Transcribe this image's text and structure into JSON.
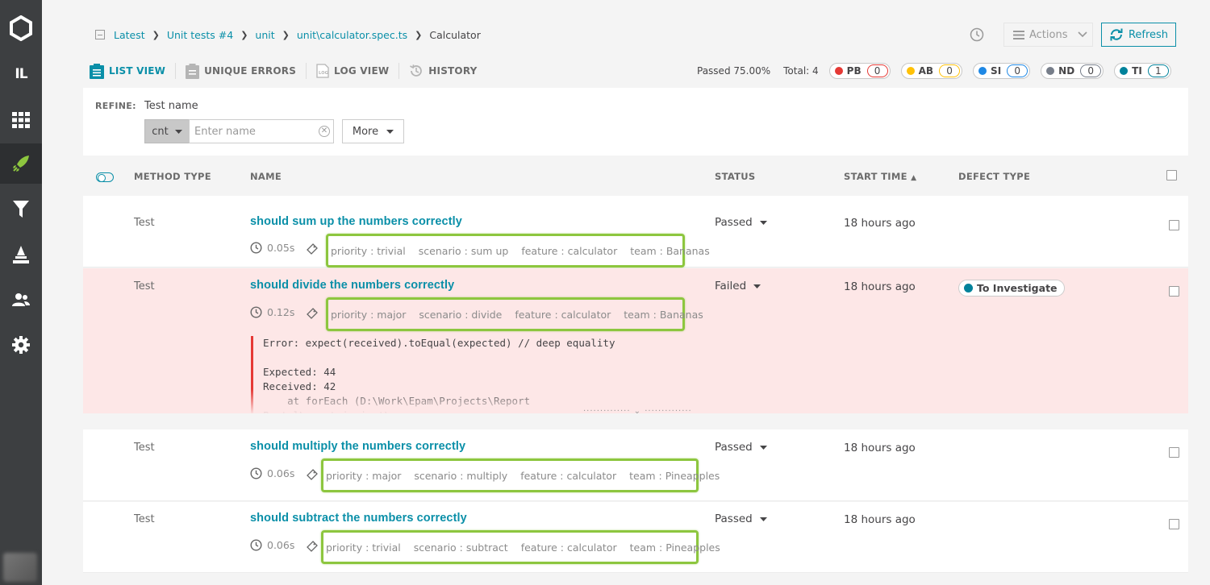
{
  "sidebar": {
    "logo": "reportportal-logo-icon",
    "project_initials": "IL"
  },
  "breadcrumb": {
    "items": [
      "Latest",
      "Unit tests #4",
      "unit",
      "unit\\calculator.spec.ts"
    ],
    "current": "Calculator"
  },
  "header": {
    "actions_label": "Actions",
    "refresh_label": "Refresh"
  },
  "view_tabs": [
    {
      "label": "LIST VIEW",
      "active": true
    },
    {
      "label": "UNIQUE ERRORS",
      "active": false
    },
    {
      "label": "LOG VIEW",
      "active": false
    },
    {
      "label": "HISTORY",
      "active": false
    }
  ],
  "stats": {
    "passed": "Passed 75.00%",
    "total": "Total: 4",
    "defects": [
      {
        "code": "PB",
        "count": "0",
        "color": "#e53935"
      },
      {
        "code": "AB",
        "count": "0",
        "color": "#ffc107"
      },
      {
        "code": "SI",
        "count": "0",
        "color": "#1e88e5"
      },
      {
        "code": "ND",
        "count": "0",
        "color": "#777e8a"
      },
      {
        "code": "TI",
        "count": "1",
        "color": "#00829b"
      }
    ]
  },
  "refine": {
    "label": "REFINE:",
    "filter_name": "Test name",
    "condition": "cnt",
    "input_placeholder": "Enter name",
    "more_label": "More"
  },
  "table": {
    "columns": {
      "method_type": "METHOD TYPE",
      "name": "NAME",
      "status": "STATUS",
      "start_time": "START TIME",
      "defect_type": "DEFECT TYPE"
    },
    "rows": [
      {
        "method_type": "Test",
        "name": "should sum up the numbers correctly",
        "duration": "0.05s",
        "attributes": [
          "priority : trivial",
          "scenario : sum up",
          "feature : calculator",
          "team : Bananas"
        ],
        "status": "Passed",
        "start_time": "18 hours ago"
      },
      {
        "method_type": "Test",
        "name": "should divide the numbers correctly",
        "duration": "0.12s",
        "attributes": [
          "priority : major",
          "scenario : divide",
          "feature : calculator",
          "team : Bananas"
        ],
        "status": "Failed",
        "start_time": "18 hours ago",
        "defect": "To Investigate",
        "log": "Error: expect(received).toEqual(expected) // deep equality\n\nExpected: 44\nReceived: 42\n    at forEach (D:\\Work\\Epam\\Projects\\Report\nPortal\\agent-js-jest\\..."
      },
      {
        "method_type": "Test",
        "name": "should multiply the numbers correctly",
        "duration": "0.06s",
        "attributes": [
          "priority : major",
          "scenario : multiply",
          "feature : calculator",
          "team : Pineapples"
        ],
        "status": "Passed",
        "start_time": "18 hours ago"
      },
      {
        "method_type": "Test",
        "name": "should subtract the numbers correctly",
        "duration": "0.06s",
        "attributes": [
          "priority : trivial",
          "scenario : subtract",
          "feature : calculator",
          "team : Pineapples"
        ],
        "status": "Passed",
        "start_time": "18 hours ago"
      }
    ]
  }
}
